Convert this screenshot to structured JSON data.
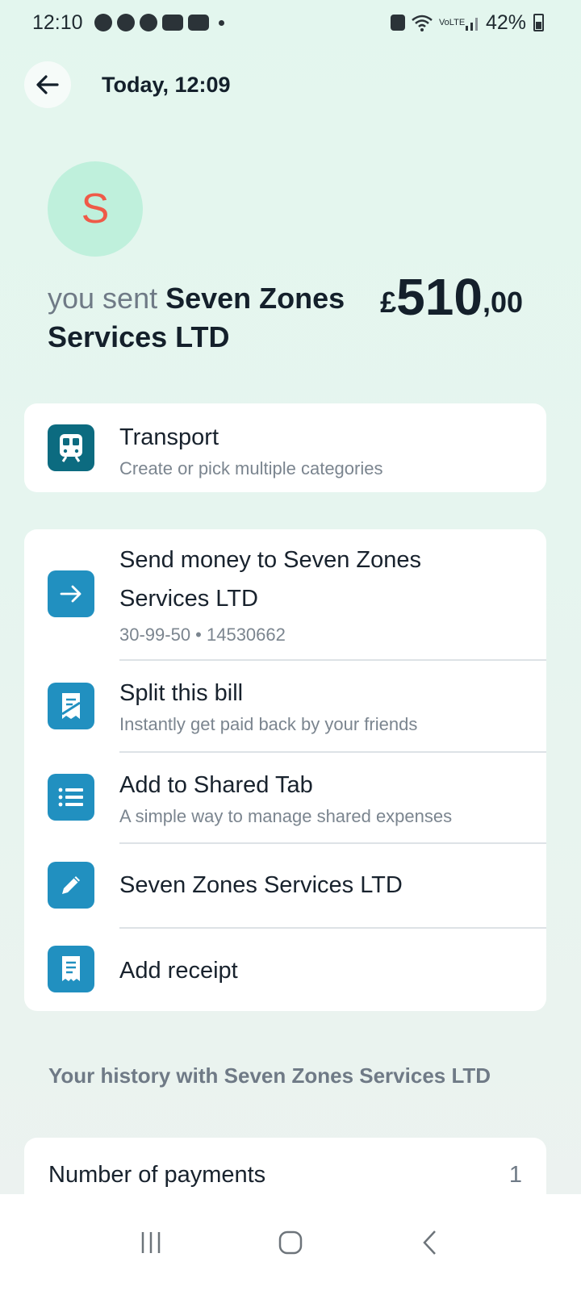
{
  "status_bar": {
    "time": "12:10",
    "battery": "42%",
    "network": "VoLTE",
    "icons": [
      "facebook-icon",
      "facebook-icon",
      "facebook-icon",
      "youtube-icon",
      "youtube-icon",
      "dot-icon",
      "wifi-icon",
      "signal-icon",
      "battery-icon"
    ]
  },
  "header": {
    "title": "Today, 12:09"
  },
  "avatar": {
    "initial": "S",
    "bg_color": "#bff0dc",
    "fg_color": "#ef5a48"
  },
  "summary": {
    "prefix": "you sent ",
    "payee": "Seven Zones Services LTD",
    "amount_currency": "£",
    "amount_whole": "510",
    "amount_decimal": ",00"
  },
  "category": {
    "title": "Transport",
    "subtitle": "Create or pick multiple categories",
    "icon": "train-icon",
    "icon_color": "#0c6b80"
  },
  "actions": [
    {
      "title": "Send money to Seven Zones Services LTD",
      "subtitle": "30-99-50 • 14530662",
      "icon": "arrow-right-icon"
    },
    {
      "title": "Split this bill",
      "subtitle": "Instantly get paid back by your friends",
      "icon": "split-bill-icon"
    },
    {
      "title": "Add to Shared Tab",
      "subtitle": "A simple way to manage shared expenses",
      "icon": "list-icon"
    },
    {
      "title": "Seven Zones Services LTD",
      "subtitle": "",
      "icon": "pencil-icon"
    },
    {
      "title": "Add receipt",
      "subtitle": "",
      "icon": "receipt-icon"
    }
  ],
  "action_icon_color": "#2190c0",
  "history": {
    "title": "Your history with Seven Zones Services LTD",
    "rows": [
      {
        "label": "Number of payments",
        "value": "1"
      }
    ]
  }
}
